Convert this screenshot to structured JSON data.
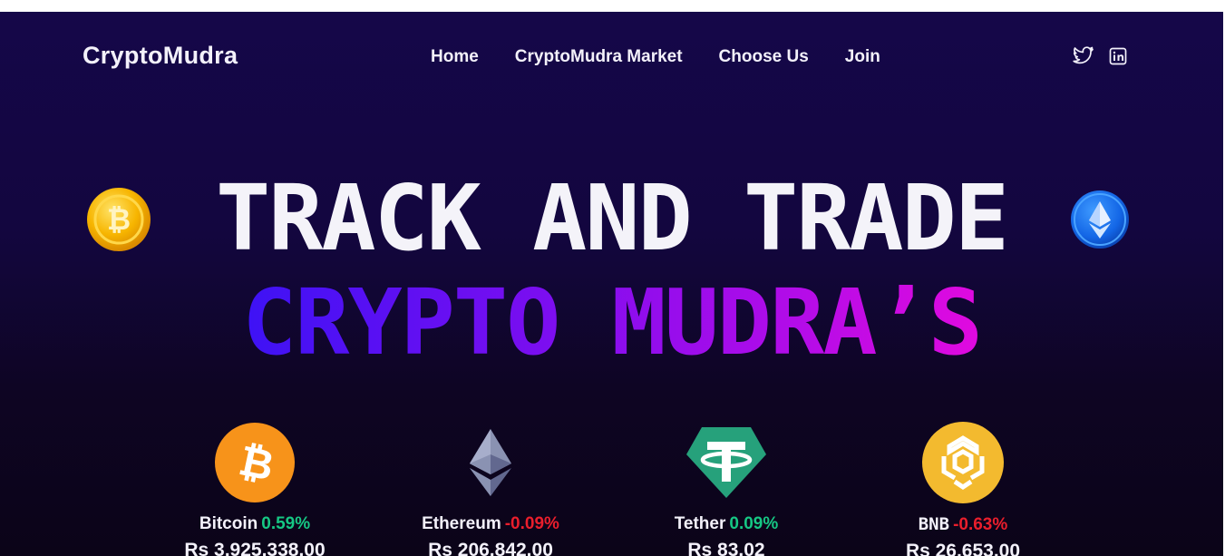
{
  "brand": "CryptoMudra",
  "nav": [
    {
      "label": "Home"
    },
    {
      "label": "CryptoMudra Market"
    },
    {
      "label": "Choose Us"
    },
    {
      "label": "Join"
    }
  ],
  "socials": [
    {
      "icon": "twitter-icon"
    },
    {
      "icon": "linkedin-icon"
    }
  ],
  "hero": {
    "line1": "TRACK AND TRADE",
    "line2": "CRYPTO MUDRA’S",
    "left_coin_icon": "bitcoin-coin-icon",
    "right_coin_icon": "ethereum-coin-icon"
  },
  "coins": [
    {
      "name": "Bitcoin",
      "change": "0.59%",
      "direction": "up",
      "price": "Rs 3,925,338.00",
      "icon": "bitcoin-icon",
      "color": "#f7931a"
    },
    {
      "name": "Ethereum",
      "change": "-0.09%",
      "direction": "down",
      "price": "Rs 206,842.00",
      "icon": "ethereum-icon",
      "color": "#8a92b2"
    },
    {
      "name": "Tether",
      "change": "0.09%",
      "direction": "up",
      "price": "Rs 83.02",
      "icon": "tether-icon",
      "color": "#26a17b"
    },
    {
      "name": "BNB",
      "change": "-0.63%",
      "direction": "down",
      "price": "Rs 26,653.00",
      "icon": "bnb-icon",
      "color": "#f3ba2f"
    }
  ],
  "colors": {
    "background_top": "#150749",
    "background_bottom": "#0b0418",
    "gradient_start": "#3d12f5",
    "gradient_end": "#e10adf",
    "positive": "#16c784",
    "negative": "#ea1e2c"
  }
}
